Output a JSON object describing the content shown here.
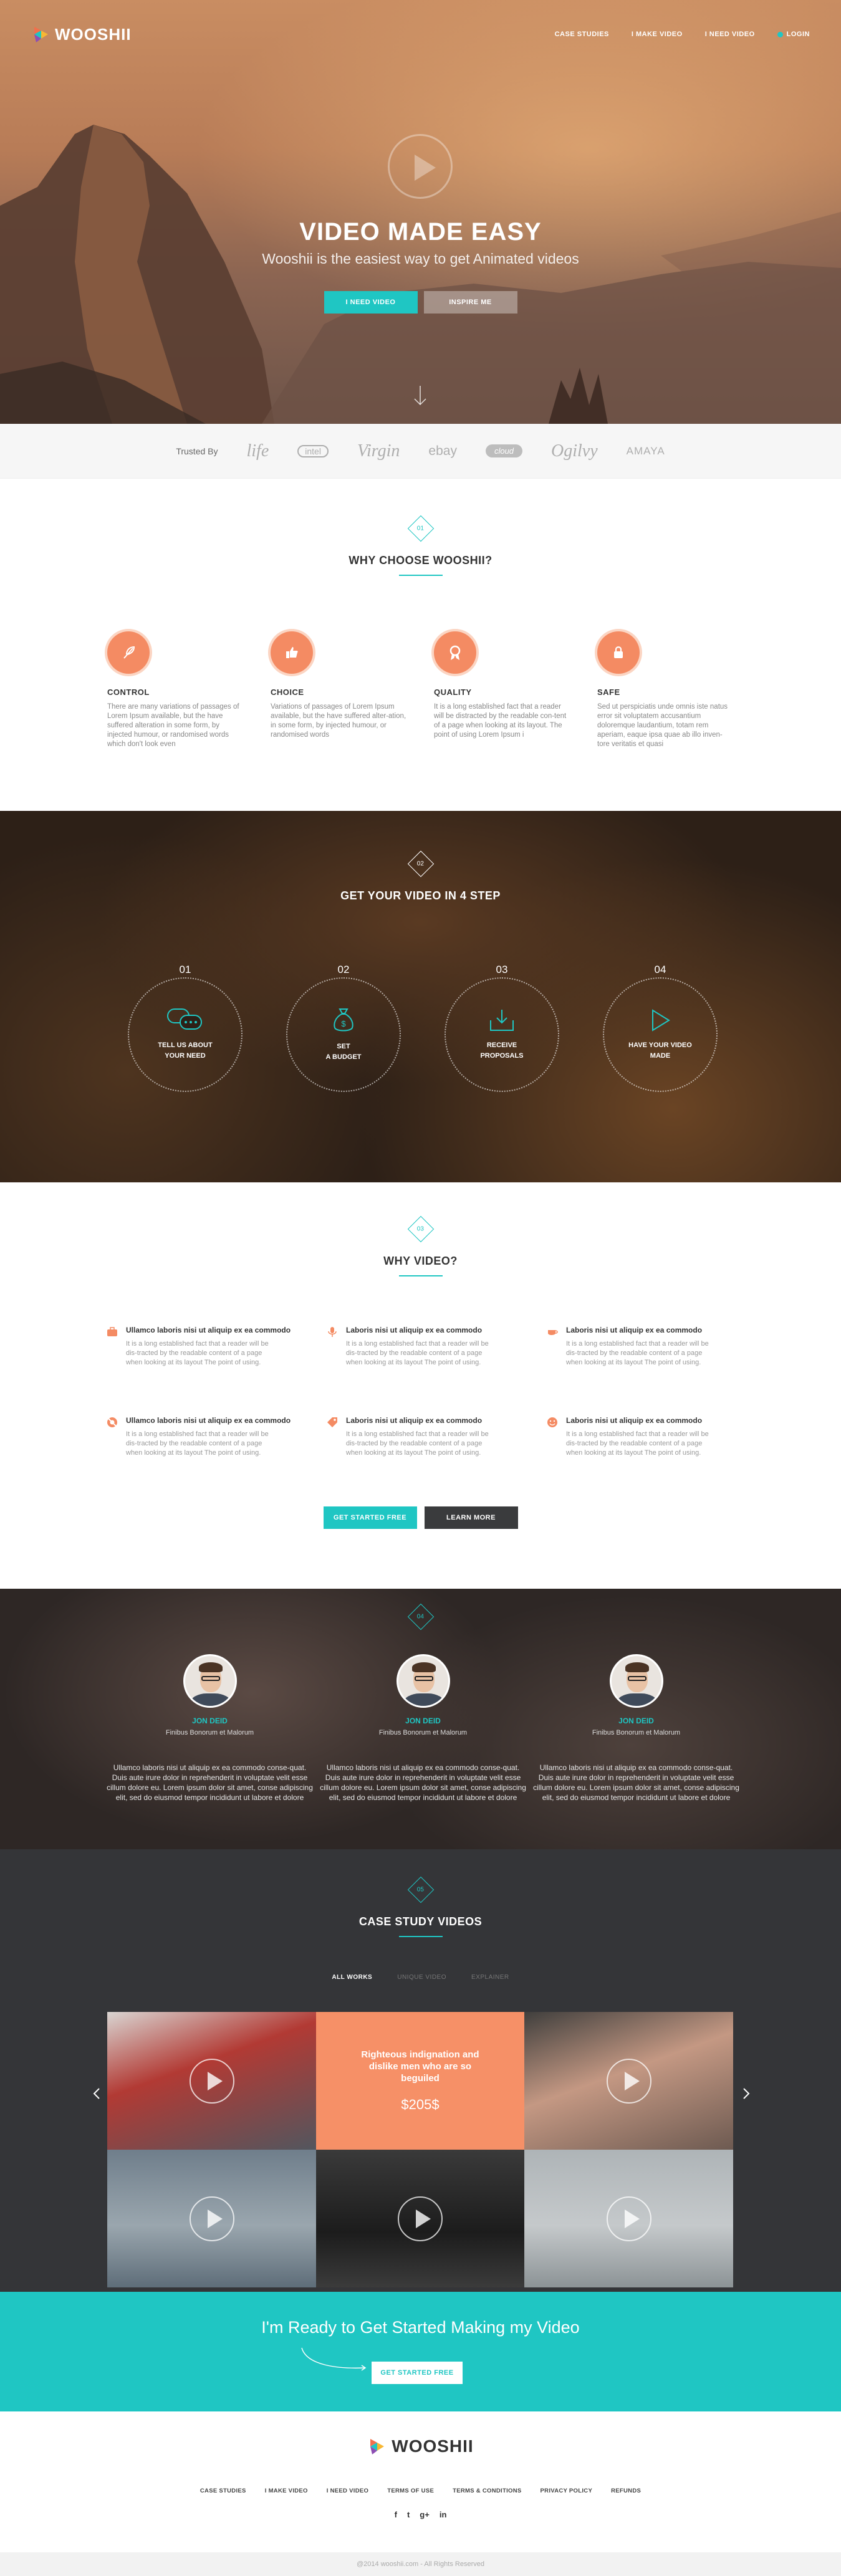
{
  "brand": {
    "name": "WOOSHII",
    "colors": {
      "teal": "#1fc6c3",
      "orange": "#f48b63",
      "dark": "#343538"
    }
  },
  "nav": {
    "items": [
      "CASE STUDIES",
      "I MAKE VIDEO",
      "I NEED VIDEO"
    ],
    "login": "LOGIN"
  },
  "hero": {
    "title": "VIDEO MADE EASY",
    "subtitle": "Wooshii is the easiest way to get Animated videos",
    "primary_button": "I NEED VIDEO",
    "secondary_button": "INSPIRE ME",
    "icons": [
      "play-icon",
      "arrow-down-icon"
    ]
  },
  "trusted": {
    "label": "Trusted By",
    "brands": [
      "life",
      "intel",
      "Virgin",
      "ebay",
      "cloud",
      "Ogilvy",
      "AMAYA"
    ]
  },
  "why_choose": {
    "number": "01",
    "title": "WHY CHOOSE WOOSHII?",
    "features": [
      {
        "icon": "feather-icon",
        "title": "CONTROL",
        "text": "There are many variations of passages of Lorem Ipsum available, but the have suffered alteration in some form, by injected humour, or randomised words which don't look even"
      },
      {
        "icon": "thumbs-up-icon",
        "title": "CHOICE",
        "text": "Variations of passages of Lorem Ipsum available, but the have suffered alter-ation, in some form, by injected humour, or randomised words"
      },
      {
        "icon": "award-icon",
        "title": "QUALITY",
        "text": "It is a long established fact that a reader will be distracted by the readable con-tent of a page when looking at its layout. The point of using Lorem Ipsum i"
      },
      {
        "icon": "lock-icon",
        "title": "SAFE",
        "text": "Sed ut perspiciatis unde omnis iste natus error sit voluptatem accusantium doloremque laudantium, totam rem aperiam, eaque ipsa quae ab illo inven-tore veritatis et quasi"
      }
    ]
  },
  "steps": {
    "number": "02",
    "title": "GET YOUR VIDEO IN 4 STEP",
    "items": [
      {
        "n": "01",
        "icon": "chat-icon",
        "line1": "TELL US ABOUT",
        "line2": "YOUR NEED"
      },
      {
        "n": "02",
        "icon": "money-bag-icon",
        "line1": "SET",
        "line2": "A BUDGET"
      },
      {
        "n": "03",
        "icon": "download-tray-icon",
        "line1": "RECEIVE",
        "line2": "PROPOSALS"
      },
      {
        "n": "04",
        "icon": "play-outline-icon",
        "line1": "HAVE YOUR VIDEO",
        "line2": "MADE"
      }
    ]
  },
  "why_video": {
    "number": "03",
    "title": "WHY VIDEO?",
    "items": [
      {
        "icon": "briefcase-icon",
        "title": "Ullamco laboris nisi ut aliquip ex ea commodo",
        "text": "It is a long established fact that a reader will be dis-tracted by the readable content of a page when looking at its layout The point of using."
      },
      {
        "icon": "microphone-icon",
        "title": "Laboris nisi ut aliquip ex ea commodo",
        "text": "It is a long established fact that a reader will be dis-tracted by the readable content of a page when looking at its layout The point of using."
      },
      {
        "icon": "coffee-cup-icon",
        "title": "Laboris nisi ut aliquip ex ea commodo",
        "text": "It is a long established fact that a reader will be dis-tracted by the readable content of a page when looking at its layout The point of using."
      },
      {
        "icon": "lifebuoy-icon",
        "title": "Ullamco laboris nisi ut aliquip ex ea commodo",
        "text": "It is a long established fact that a reader will be dis-tracted by the readable content of a page when looking at its layout The point of using."
      },
      {
        "icon": "tag-icon",
        "title": "Laboris nisi ut aliquip ex ea commodo",
        "text": "It is a long established fact that a reader will be dis-tracted by the readable content of a page when looking at its layout The point of using."
      },
      {
        "icon": "smiley-icon",
        "title": "Laboris nisi ut aliquip ex ea commodo",
        "text": "It is a long established fact that a reader will be dis-tracted by the readable content of a page when looking at its layout The point of using."
      }
    ],
    "primary_button": "GET STARTED FREE",
    "secondary_button": "LEARN MORE"
  },
  "testimonials": {
    "number": "04",
    "items": [
      {
        "name": "JON DEID",
        "role": "Finibus Bonorum et Malorum",
        "quote": "Ullamco laboris nisi ut aliquip ex ea commodo conse-quat. Duis aute irure dolor in reprehenderit in voluptate velit esse cillum dolore eu. Lorem ipsum dolor sit amet, conse adipiscing elit, sed do eiusmod tempor incididunt ut labore et dolore"
      },
      {
        "name": "JON DEID",
        "role": "Finibus Bonorum et Malorum",
        "quote": "Ullamco laboris nisi ut aliquip ex ea commodo conse-quat. Duis aute irure dolor in reprehenderit in voluptate velit esse cillum dolore eu. Lorem ipsum dolor sit amet, conse adipiscing elit, sed do eiusmod tempor incididunt ut labore et dolore"
      },
      {
        "name": "JON DEID",
        "role": "Finibus Bonorum et Malorum",
        "quote": "Ullamco laboris nisi ut aliquip ex ea commodo conse-quat. Duis aute irure dolor in reprehenderit in voluptate velit esse cillum dolore eu. Lorem ipsum dolor sit amet, conse adipiscing elit, sed do eiusmod tempor incididunt ut labore et dolore"
      }
    ]
  },
  "cases": {
    "number": "05",
    "title": "CASE STUDY VIDEOS",
    "filters": [
      "ALL WORKS",
      "UNIQUE VIDEO",
      "EXPLAINER"
    ],
    "active_filter": "ALL WORKS",
    "highlight": {
      "text": "Righteous indignation and dislike men who are so beguiled",
      "price": "$205$"
    }
  },
  "cta": {
    "text": "I'm Ready to Get Started Making my Video",
    "button": "GET STARTED FREE"
  },
  "footer": {
    "logo": "WOOSHII",
    "links": [
      "CASE STUDIES",
      "I MAKE VIDEO",
      "I NEED VIDEO",
      "TERMS OF USE",
      "TERMS & CONDITIONS",
      "PRIVACY POLICY",
      "REFUNDS"
    ],
    "social": [
      "f",
      "t",
      "g+",
      "in"
    ],
    "social_icons": [
      "facebook-icon",
      "twitter-icon",
      "google-plus-icon",
      "linkedin-icon"
    ],
    "copyright": "@2014 wooshii.com - All Rights Reserved"
  }
}
